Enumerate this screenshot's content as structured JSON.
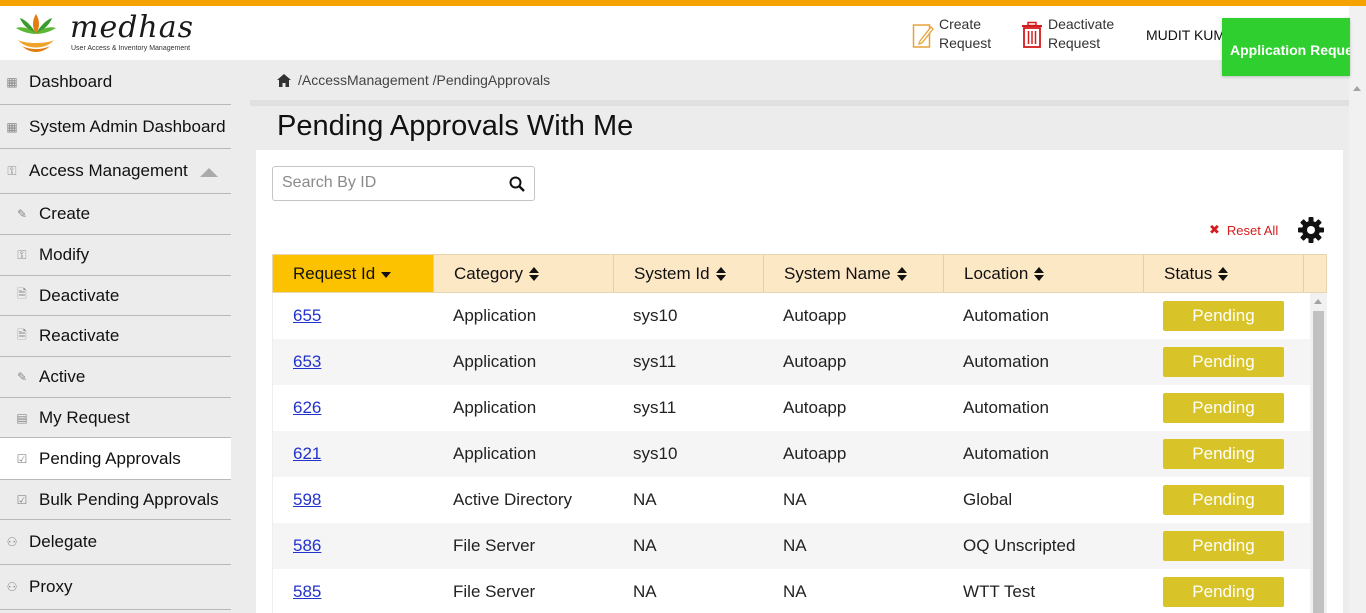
{
  "brand": {
    "name": "medhas",
    "tagline": "User Access & Inventory Management"
  },
  "header": {
    "create_label": "Create Request",
    "deactivate_label": "Deactivate Request",
    "username": "MUDIT KUMBHKAR",
    "toast": "Application Request"
  },
  "sidebar": {
    "items": [
      {
        "label": "Dashboard",
        "icon": "grid-icon"
      },
      {
        "label": "System Admin Dashboard",
        "icon": "grid-icon"
      },
      {
        "label": "Access Management",
        "icon": "key-icon",
        "expanded": true
      },
      {
        "label": "Create",
        "icon": "edit-icon"
      },
      {
        "label": "Modify",
        "icon": "key-icon"
      },
      {
        "label": "Deactivate",
        "icon": "document-icon"
      },
      {
        "label": "Reactivate",
        "icon": "document-icon"
      },
      {
        "label": "Active",
        "icon": "edit-icon"
      },
      {
        "label": "My Request",
        "icon": "table-icon"
      },
      {
        "label": "Pending Approvals",
        "icon": "clipboard-icon",
        "active": true
      },
      {
        "label": "Bulk Pending Approvals",
        "icon": "clipboard-icon"
      },
      {
        "label": "Delegate",
        "icon": "people-icon"
      },
      {
        "label": "Proxy",
        "icon": "people-icon"
      }
    ]
  },
  "breadcrumb": "/AccessManagement /PendingApprovals",
  "page": {
    "title": "Pending Approvals With Me"
  },
  "search": {
    "placeholder": "Search By ID",
    "value": ""
  },
  "toolbar": {
    "reset_label": "Reset All"
  },
  "table": {
    "columns": [
      "Request Id",
      "Category",
      "System Id",
      "System Name",
      "Location",
      "Status"
    ],
    "sorted_column": "Request Id",
    "sort_direction": "desc",
    "rows": [
      {
        "id": "655",
        "category": "Application",
        "system_id": "sys10",
        "system_name": "Autoapp",
        "location": "Automation",
        "status": "Pending"
      },
      {
        "id": "653",
        "category": "Application",
        "system_id": "sys11",
        "system_name": "Autoapp",
        "location": "Automation",
        "status": "Pending"
      },
      {
        "id": "626",
        "category": "Application",
        "system_id": "sys11",
        "system_name": "Autoapp",
        "location": "Automation",
        "status": "Pending"
      },
      {
        "id": "621",
        "category": "Application",
        "system_id": "sys10",
        "system_name": "Autoapp",
        "location": "Automation",
        "status": "Pending"
      },
      {
        "id": "598",
        "category": "Active Directory",
        "system_id": "NA",
        "system_name": "NA",
        "location": "Global",
        "status": "Pending"
      },
      {
        "id": "586",
        "category": "File Server",
        "system_id": "NA",
        "system_name": "NA",
        "location": "OQ Unscripted",
        "status": "Pending"
      },
      {
        "id": "585",
        "category": "File Server",
        "system_id": "NA",
        "system_name": "NA",
        "location": "WTT Test",
        "status": "Pending"
      }
    ]
  },
  "colors": {
    "accent": "#f5a300",
    "sorted_header": "#fcc200",
    "header_bg": "#fde8c6",
    "pending": "#d8c428",
    "toast": "#2fcf2f",
    "reset": "#d51c1c"
  }
}
